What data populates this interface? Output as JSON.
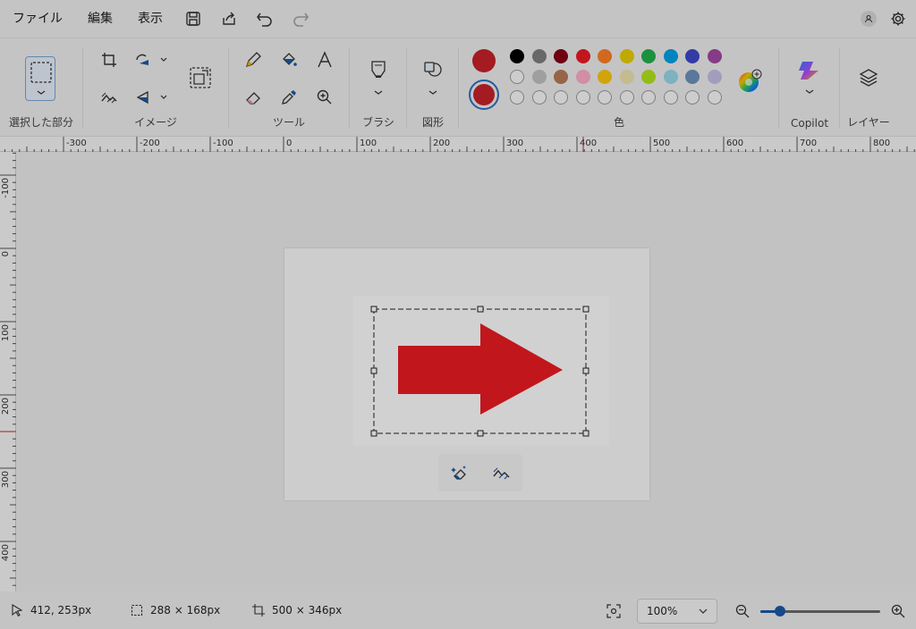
{
  "menu": {
    "file": "ファイル",
    "edit": "編集",
    "view": "表示"
  },
  "ribbon": {
    "selection_label": "選択した部分",
    "image_label": "イメージ",
    "tools_label": "ツール",
    "brush_label": "ブラシ",
    "shapes_label": "図形",
    "colors_label": "色",
    "copilot_label": "Copilot",
    "layers_label": "レイヤー"
  },
  "colors": {
    "primary": "#c8222a",
    "secondary": "#c8222a",
    "row1": [
      "#000000",
      "#7f7f7f",
      "#880015",
      "#ed1c24",
      "#ff7f27",
      "#e8d000",
      "#22b14c",
      "#00a2e8",
      "#3f48cc",
      "#a349a4"
    ],
    "row2": [
      "",
      "#c3c3c3",
      "#b97a57",
      "#ffaec9",
      "#ffc90e",
      "#efe4b0",
      "#b5e61d",
      "#99d9ea",
      "#7092be",
      "#c8bfe7"
    ],
    "row3_count": 10
  },
  "ruler": {
    "h_labels": [
      "-300",
      "-200",
      "-100",
      "0",
      "100",
      "200",
      "300",
      "400",
      "500",
      "600",
      "700",
      "800"
    ],
    "v_labels": [
      "-100",
      "0",
      "100",
      "200",
      "300",
      "400"
    ]
  },
  "drawing": {
    "arrow_color": "#ed1c24"
  },
  "status": {
    "cursor_pos": "412, 253px",
    "selection_size": "288 × 168px",
    "canvas_size": "500 × 346px",
    "zoom": "100%"
  }
}
